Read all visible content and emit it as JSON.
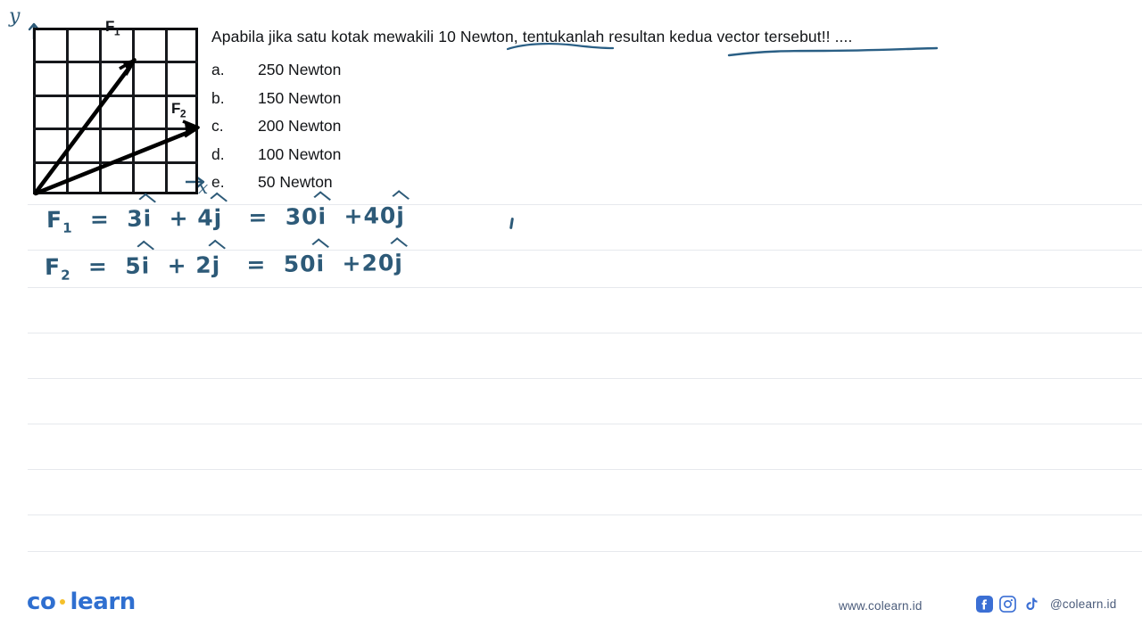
{
  "diagram": {
    "y_axis_label": "y",
    "x_axis_label": "x",
    "grid_cols": 5,
    "grid_rows": 5,
    "vectors": [
      {
        "name": "F",
        "subscript": "1",
        "from": [
          0,
          0
        ],
        "to": [
          3,
          4
        ]
      },
      {
        "name": "F",
        "subscript": "2",
        "from": [
          0,
          0
        ],
        "to": [
          5,
          2
        ]
      }
    ]
  },
  "question": {
    "text": "Apabila jika satu kotak mewakili 10 Newton, tentukanlah resultan kedua vector tersebut!! ....",
    "underline_1_phrase": "10 Newton",
    "underline_2_phrase": "tentukanlah resultan kedua"
  },
  "options": [
    {
      "letter": "a.",
      "text": "250 Newton"
    },
    {
      "letter": "b.",
      "text": "150 Newton"
    },
    {
      "letter": "c.",
      "text": "200 Newton"
    },
    {
      "letter": "d.",
      "text": "100 Newton"
    },
    {
      "letter": "e.",
      "text": "50 Newton"
    }
  ],
  "handwriting": {
    "line1": {
      "lhs": "F",
      "lhs_sub": "1",
      "eq1_i": "3",
      "eq1_j": "4",
      "eq2_i": "30",
      "eq2_j": "40",
      "full": "F1 = 3i + 4j = 30i + 40j"
    },
    "line2": {
      "lhs": "F",
      "lhs_sub": "2",
      "eq1_i": "5",
      "eq1_j": "2",
      "eq2_i": "50",
      "eq2_j": "20",
      "full": "F2 = 5i + 2j = 50i + 20j"
    },
    "ink_color": "#2d5a78"
  },
  "footer": {
    "logo_first": "co",
    "logo_second": "learn",
    "site_url": "www.colearn.id",
    "social_handle": "@colearn.id",
    "brand_color": "#2f6fd0",
    "dot_color": "#f5c02a",
    "socials": [
      "facebook-icon",
      "instagram-icon",
      "tiktok-icon"
    ]
  },
  "rule_lines_y": [
    229,
    280,
    322,
    373,
    424,
    475,
    526,
    577,
    618
  ]
}
